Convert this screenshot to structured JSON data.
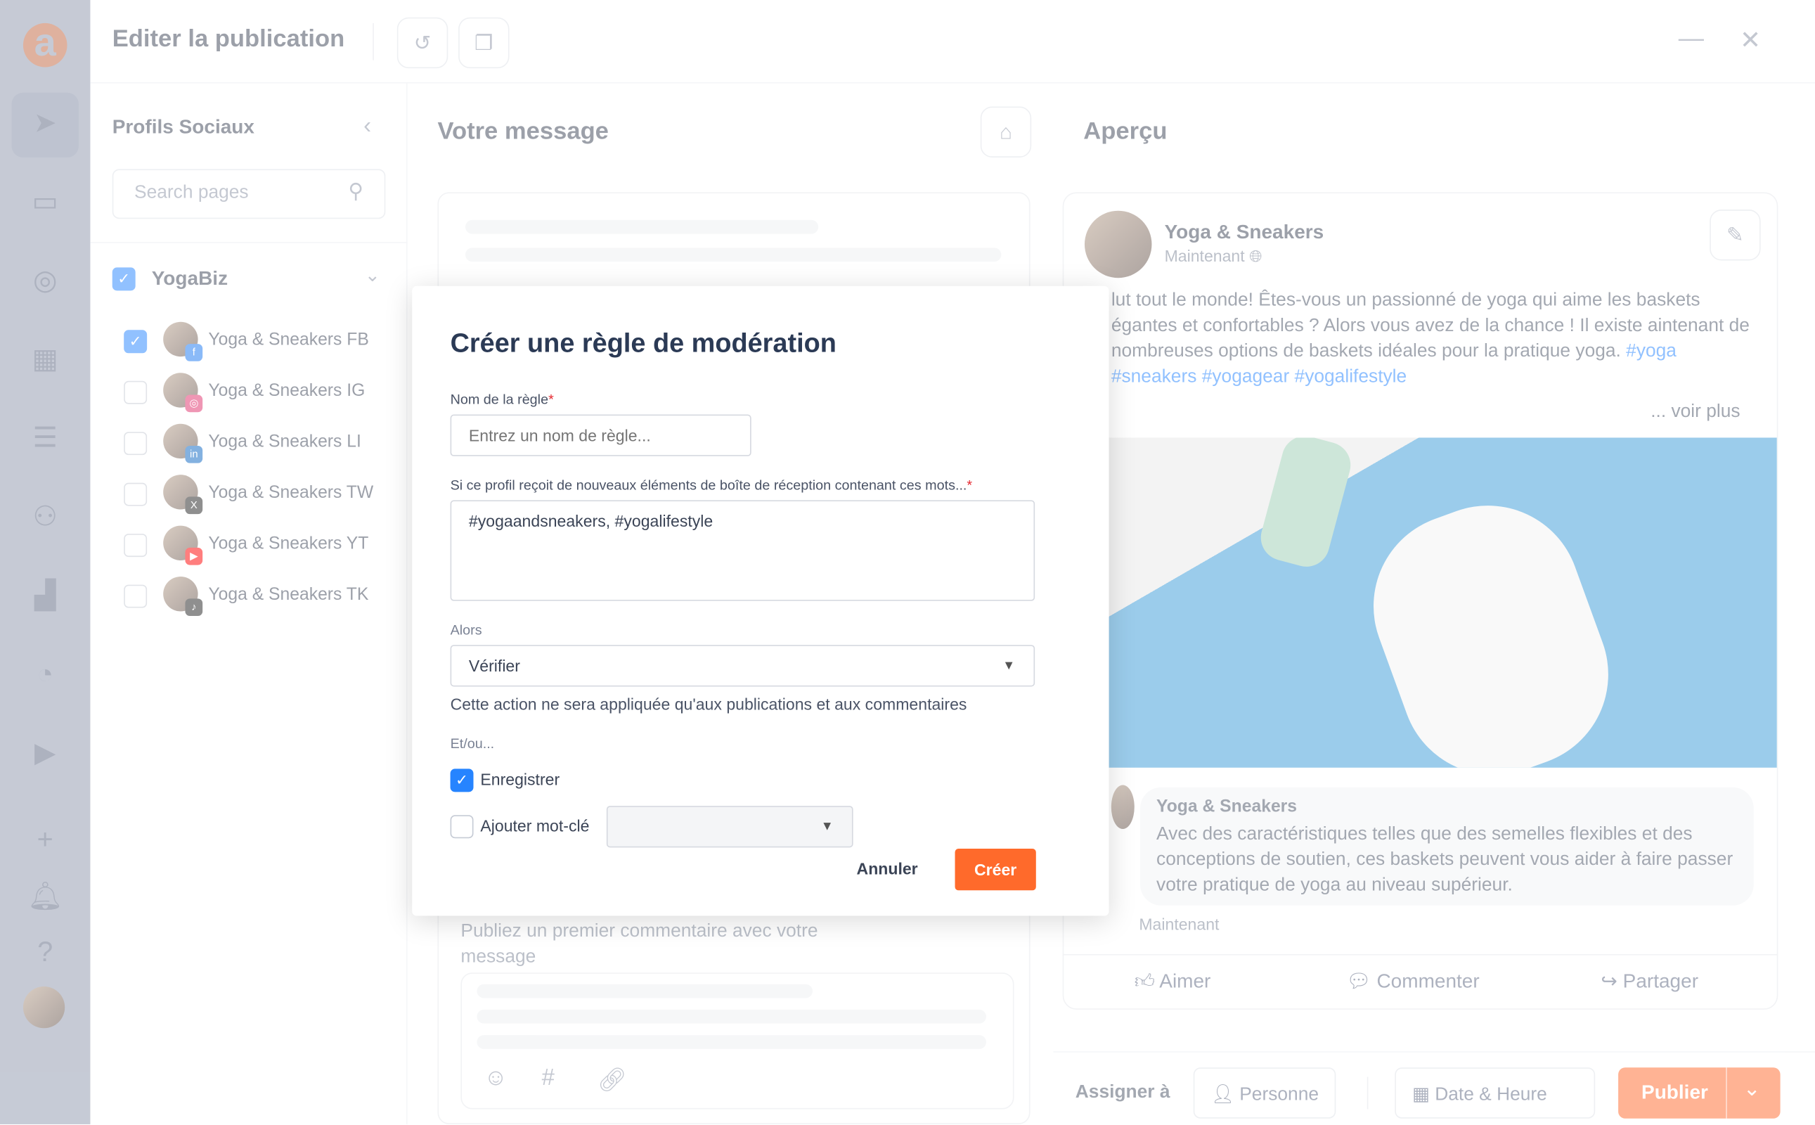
{
  "header": {
    "title": "Editer la publication",
    "history_icon": "history-icon",
    "comment_icon": "comment-icon"
  },
  "rail": {
    "logo": "a",
    "icons": [
      "send-icon",
      "inbox-icon",
      "globe-search-icon",
      "calendar-icon",
      "list-calendar-icon",
      "users-icon",
      "analytics-icon",
      "gauge-icon",
      "media-icon",
      "plus-icon",
      "bell-icon",
      "help-icon"
    ]
  },
  "sidebar": {
    "title": "Profils Sociaux",
    "search_placeholder": "Search pages",
    "group": {
      "name": "YogaBiz",
      "checked": true
    },
    "profiles": [
      {
        "name": "Yoga & Sneakers FB",
        "network": "facebook",
        "color": "#1877f2",
        "glyph": "f",
        "checked": true
      },
      {
        "name": "Yoga & Sneakers IG",
        "network": "instagram",
        "color": "#e1306c",
        "glyph": "◎",
        "checked": false
      },
      {
        "name": "Yoga & Sneakers LI",
        "network": "linkedin",
        "color": "#0a66c2",
        "glyph": "in",
        "checked": false
      },
      {
        "name": "Yoga & Sneakers TW",
        "network": "x",
        "color": "#222222",
        "glyph": "X",
        "checked": false
      },
      {
        "name": "Yoga & Sneakers YT",
        "network": "youtube",
        "color": "#ff0000",
        "glyph": "▶",
        "checked": false
      },
      {
        "name": "Yoga & Sneakers TK",
        "network": "tiktok",
        "color": "#222222",
        "glyph": "♪",
        "checked": false
      }
    ]
  },
  "message": {
    "title": "Votre message",
    "first_comment": "Publiez un premier commentaire avec votre message"
  },
  "preview": {
    "title": "Aperçu",
    "page_name": "Yoga & Sneakers",
    "time": "Maintenant",
    "text": "lut tout le monde! Êtes-vous un passionné de yoga qui aime les baskets égantes et confortables ? Alors vous avez de la chance ! Il existe aintenant de nombreuses options de baskets idéales pour la pratique yoga.",
    "hashtags": "#yoga #sneakers #yogagear #yogalifestyle",
    "see_more": "... voir plus",
    "comment": {
      "author": "Yoga & Sneakers",
      "text": "Avec des caractéristiques telles que des semelles flexibles et des conceptions de soutien, ces baskets peuvent vous aider à faire passer votre pratique de yoga au niveau supérieur.",
      "time": "Maintenant"
    },
    "actions": {
      "like": "Aimer",
      "comment": "Commenter",
      "share": "Partager"
    }
  },
  "footer": {
    "assign_label": "Assigner à",
    "person": "Personne",
    "datetime": "Date & Heure",
    "publish": "Publier",
    "accent": "#ff6a2b"
  },
  "modal": {
    "title": "Créer une règle de modération",
    "rule_name_label": "Nom de la règle",
    "rule_name_placeholder": "Entrez un nom de règle...",
    "words_label": "Si ce profil reçoit de nouveaux éléments de boîte de réception contenant ces mots...",
    "words_value": "#yogaandsneakers, #yogalifestyle",
    "then_label": "Alors",
    "then_value": "Vérifier",
    "then_note": "Cette action ne sera appliquée qu'aux publications et aux commentaires",
    "andor_label": "Et/ou...",
    "save_label": "Enregistrer",
    "save_checked": true,
    "keyword_label": "Ajouter mot-clé",
    "keyword_checked": false,
    "keyword_value": "",
    "required_mark": "*",
    "cancel": "Annuler",
    "create": "Créer"
  }
}
